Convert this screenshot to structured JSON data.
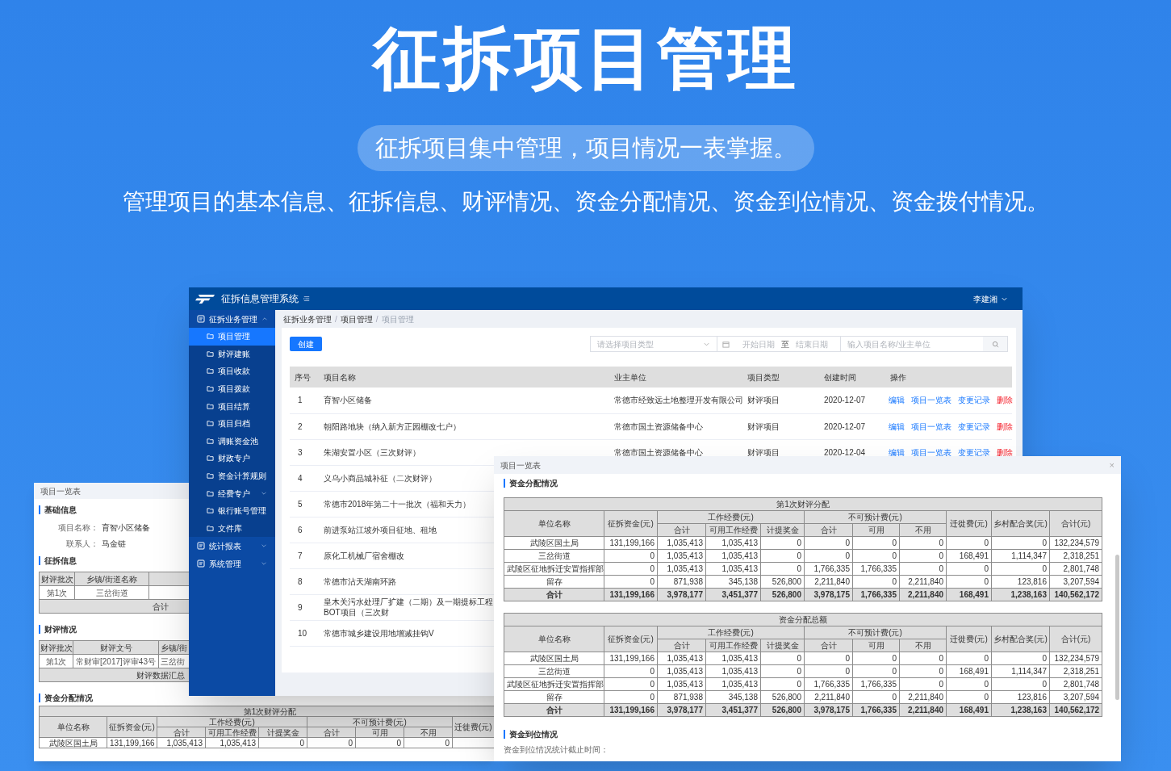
{
  "hero": {
    "title": "征拆项目管理",
    "subtitle": "征拆项目集中管理，项目情况一表掌握。",
    "description": "管理项目的基本信息、征拆信息、财评情况、资金分配情况、资金到位情况、资金拨付情况。"
  },
  "app": {
    "brand": "征拆信息管理系统",
    "user": "李建湘",
    "sidebar": [
      {
        "label": "征拆业务管理",
        "expanded": true,
        "children": [
          {
            "label": "项目管理",
            "kind": "page",
            "selected": true
          },
          {
            "label": "财评建账",
            "kind": "page",
            "selected": false
          },
          {
            "label": "项目收款",
            "kind": "page",
            "selected": false
          },
          {
            "label": "项目拨款",
            "kind": "page",
            "selected": false
          },
          {
            "label": "项目结算",
            "kind": "page",
            "selected": false
          },
          {
            "label": "项目归档",
            "kind": "page",
            "selected": false
          },
          {
            "label": "调账资金池",
            "kind": "page",
            "selected": false
          },
          {
            "label": "财政专户",
            "kind": "page",
            "selected": false
          },
          {
            "label": "资金计算规则",
            "kind": "page",
            "selected": false
          },
          {
            "label": "经费专户",
            "kind": "group",
            "selected": false
          },
          {
            "label": "银行账号管理",
            "kind": "page",
            "selected": false
          },
          {
            "label": "文件库",
            "kind": "page",
            "selected": false
          }
        ]
      },
      {
        "label": "统计报表",
        "expanded": false
      },
      {
        "label": "系统管理",
        "expanded": false
      }
    ],
    "breadcrumb": [
      "征拆业务管理",
      "项目管理",
      "项目管理"
    ],
    "breadcrumb_separator": "/",
    "create_button": "创建",
    "filters": {
      "type_select": {
        "placeholder": "请选择项目类型"
      },
      "start_date": {
        "placeholder": "开始日期"
      },
      "range_separator": "至",
      "end_date": {
        "placeholder": "结束日期"
      },
      "search": {
        "placeholder": "输入项目名称/业主单位"
      }
    },
    "table": {
      "columns": [
        "序号",
        "项目名称",
        "业主单位",
        "项目类型",
        "创建时间",
        "操作"
      ],
      "rows": [
        {
          "no": "1",
          "name": "育智小区储备",
          "owner": "常德市经致远土地整理开发有限公司",
          "type": "财评项目",
          "created": "2020-12-07",
          "actions": [
            {
              "label": "编辑",
              "kind": "link"
            },
            {
              "label": "项目一览表",
              "kind": "link"
            },
            {
              "label": "变更记录",
              "kind": "link"
            },
            {
              "label": "删除",
              "kind": "danger"
            }
          ]
        },
        {
          "no": "2",
          "name": "朝阳路地块（纳入新方正园棚改七户）",
          "owner": "常德市国土资源储备中心",
          "type": "财评项目",
          "created": "2020-12-07",
          "actions": [
            {
              "label": "编辑",
              "kind": "link"
            },
            {
              "label": "项目一览表",
              "kind": "link"
            },
            {
              "label": "变更记录",
              "kind": "link"
            },
            {
              "label": "删除",
              "kind": "danger"
            }
          ]
        },
        {
          "no": "3",
          "name": "朱湖安置小区（三次财评）",
          "owner": "常德市国土资源储备中心",
          "type": "财评项目",
          "created": "2020-12-04",
          "actions": [
            {
              "label": "编辑",
              "kind": "link"
            },
            {
              "label": "项目一览表",
              "kind": "link"
            },
            {
              "label": "变更记录",
              "kind": "link"
            },
            {
              "label": "删除",
              "kind": "danger"
            }
          ]
        },
        {
          "no": "4",
          "name": "义乌小商品城补征（二次财评）"
        },
        {
          "no": "5",
          "name": "常德市2018年第二十一批次（福和天力）"
        },
        {
          "no": "6",
          "name": "前进泵站江坡外项目征地、租地"
        },
        {
          "no": "7",
          "name": "原化工机械厂宿舍棚改"
        },
        {
          "no": "8",
          "name": "常德市沾天湖南环路"
        },
        {
          "no": "9",
          "name": "皇木关污水处理厂扩建（二期）及一期提标工程BOT项目（三次财"
        },
        {
          "no": "10",
          "name": "常德市城乡建设用地增减挂钩V"
        }
      ]
    }
  },
  "back_window": {
    "title": "项目一览表",
    "basic": {
      "heading": "基础信息",
      "fields": [
        {
          "label": "项目名称：",
          "value": "育智小区储备"
        },
        {
          "label": "联系人：",
          "value": "马金链"
        }
      ]
    },
    "demolition": {
      "heading": "征拆信息",
      "columns": [
        "财评批次",
        "乡镇/街道名称"
      ],
      "row": [
        "第1次",
        "三岔街道"
      ],
      "total": "合计"
    },
    "evaluation": {
      "heading": "财评情况",
      "columns": [
        "财评批次",
        "财评文号",
        "乡镇/街"
      ],
      "row": [
        "第1次",
        "常财审[2017]评审43号",
        "三岔街"
      ],
      "summary": "财评数据汇总"
    },
    "allocation": {
      "heading": "资金分配情况",
      "table": {
        "title": "第1次财评分配",
        "header": {
          "unit": "单位名称",
          "funds": "征拆资金(元)",
          "groups": [
            {
              "label": "工作经费(元)",
              "columns": [
                "合计",
                "可用工作经费",
                "计提奖金"
              ]
            },
            {
              "label": "不可预计费(元)",
              "columns": [
                "合计",
                "可用",
                "不用"
              ]
            }
          ],
          "tail": [
            "迁徙费(元)"
          ]
        },
        "rows": [
          {
            "kind": "data",
            "cells": [
              "武陵区国土局",
              "131,199,166",
              "1,035,413",
              "1,035,413",
              "0",
              "0",
              "0",
              "0"
            ]
          }
        ]
      }
    }
  },
  "popup": {
    "title": "项目一览表",
    "close": "×",
    "section": "资金分配情况",
    "tables": [
      {
        "title": "第1次财评分配",
        "header": {
          "unit": "单位名称",
          "funds": "征拆资金(元)",
          "groups": [
            {
              "label": "工作经费(元)",
              "columns": [
                "合计",
                "可用工作经费",
                "计提奖金"
              ]
            },
            {
              "label": "不可预计费(元)",
              "columns": [
                "合计",
                "可用",
                "不用"
              ]
            }
          ],
          "tail": [
            "迁徙费(元)",
            "乡村配合奖(元)",
            "合计(元)"
          ]
        },
        "rows": [
          {
            "kind": "data",
            "cells": [
              "武陵区国土局",
              "131,199,166",
              "1,035,413",
              "1,035,413",
              "0",
              "0",
              "0",
              "0",
              "0",
              "0",
              "132,234,579"
            ]
          },
          {
            "kind": "data",
            "cells": [
              "三岔街道",
              "0",
              "1,035,413",
              "1,035,413",
              "0",
              "0",
              "0",
              "0",
              "168,491",
              "1,114,347",
              "2,318,251"
            ]
          },
          {
            "kind": "data",
            "cells": [
              "武陵区征地拆迁安置指挥部",
              "0",
              "1,035,413",
              "1,035,413",
              "0",
              "1,766,335",
              "1,766,335",
              "0",
              "0",
              "0",
              "2,801,748"
            ]
          },
          {
            "kind": "data",
            "cells": [
              "留存",
              "0",
              "871,938",
              "345,138",
              "526,800",
              "2,211,840",
              "0",
              "2,211,840",
              "0",
              "123,816",
              "3,207,594"
            ]
          },
          {
            "kind": "total",
            "cells": [
              "合计",
              "131,199,166",
              "3,978,177",
              "3,451,377",
              "526,800",
              "3,978,175",
              "1,766,335",
              "2,211,840",
              "168,491",
              "1,238,163",
              "140,562,172"
            ]
          }
        ]
      },
      {
        "title": "资金分配总额",
        "header": {
          "unit": "单位名称",
          "funds": "征拆资金(元)",
          "groups": [
            {
              "label": "工作经费(元)",
              "columns": [
                "合计",
                "可用工作经费",
                "计提奖金"
              ]
            },
            {
              "label": "不可预计费(元)",
              "columns": [
                "合计",
                "可用",
                "不用"
              ]
            }
          ],
          "tail": [
            "迁徙费(元)",
            "乡村配合奖(元)",
            "合计(元)"
          ]
        },
        "rows": [
          {
            "kind": "data",
            "cells": [
              "武陵区国土局",
              "131,199,166",
              "1,035,413",
              "1,035,413",
              "0",
              "0",
              "0",
              "0",
              "0",
              "0",
              "132,234,579"
            ]
          },
          {
            "kind": "data",
            "cells": [
              "三岔街道",
              "0",
              "1,035,413",
              "1,035,413",
              "0",
              "0",
              "0",
              "0",
              "168,491",
              "1,114,347",
              "2,318,251"
            ]
          },
          {
            "kind": "data",
            "cells": [
              "武陵区征地拆迁安置指挥部",
              "0",
              "1,035,413",
              "1,035,413",
              "0",
              "1,766,335",
              "1,766,335",
              "0",
              "0",
              "0",
              "2,801,748"
            ]
          },
          {
            "kind": "data",
            "cells": [
              "留存",
              "0",
              "871,938",
              "345,138",
              "526,800",
              "2,211,840",
              "0",
              "2,211,840",
              "0",
              "123,816",
              "3,207,594"
            ]
          },
          {
            "kind": "total",
            "cells": [
              "合计",
              "131,199,166",
              "3,978,177",
              "3,451,377",
              "526,800",
              "3,978,175",
              "1,766,335",
              "2,211,840",
              "168,491",
              "1,238,163",
              "140,562,172"
            ]
          }
        ]
      }
    ],
    "arrival": {
      "heading": "资金到位情况",
      "note": "资金到位情况统计截止时间："
    }
  }
}
